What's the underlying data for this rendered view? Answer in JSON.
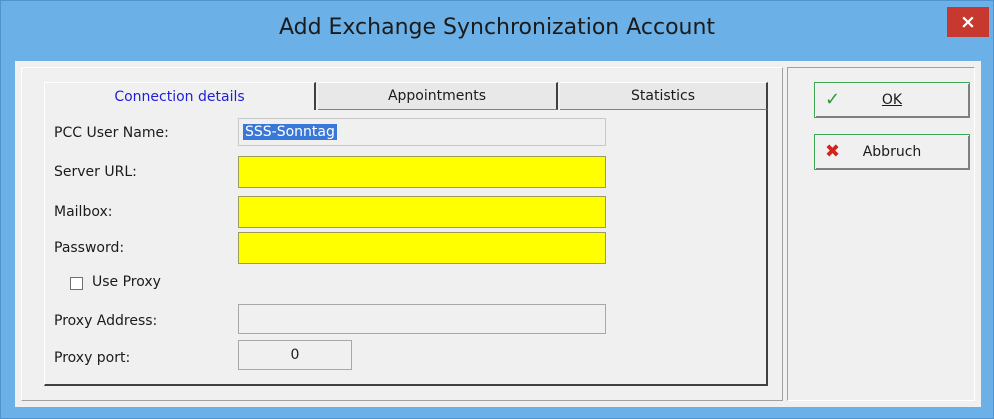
{
  "window": {
    "title": "Add Exchange Synchronization Account",
    "close_glyph": "×"
  },
  "tabs": [
    {
      "label": "Connection details",
      "active": true
    },
    {
      "label": "Appointments",
      "active": false
    },
    {
      "label": "Statistics",
      "active": false
    }
  ],
  "form": {
    "user_name_label": "PCC User Name:",
    "user_name_value": "SSS-Sonntag",
    "server_url_label": "Server URL:",
    "server_url_value": "",
    "mailbox_label": "Mailbox:",
    "mailbox_value": "",
    "password_label": "Password:",
    "password_value": "",
    "use_proxy_label": "Use Proxy",
    "use_proxy_checked": false,
    "proxy_address_label": "Proxy Address:",
    "proxy_address_value": "",
    "proxy_port_label": "Proxy port:",
    "proxy_port_value": "0"
  },
  "buttons": {
    "ok_label": "OK",
    "ok_icon": "checkmark-icon",
    "cancel_label": "Abbruch",
    "cancel_icon": "cross-icon"
  },
  "colors": {
    "title_bar": "#6bb0e6",
    "close_button": "#c7382f",
    "required_field": "#ffff00",
    "active_tab_text": "#1f1fd6",
    "selection": "#3a78d8",
    "ok_icon": "#2a9a3a",
    "cancel_icon": "#d0241c"
  }
}
